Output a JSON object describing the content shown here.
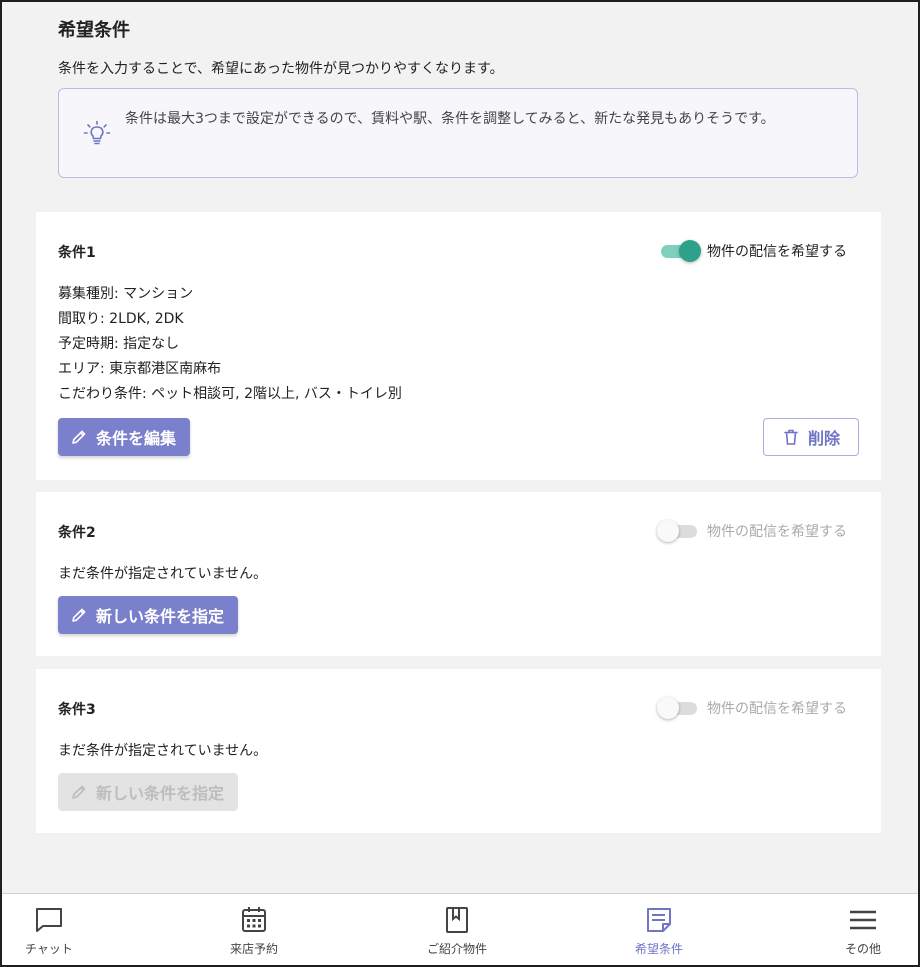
{
  "header": {
    "title": "希望条件",
    "description": "条件を入力することで、希望にあった物件が見つかりやすくなります。",
    "tip_icon": "lightbulb-icon",
    "tip_text": "条件は最大3つまで設定ができるので、賃料や駅、条件を調整してみると、新たな発見もありそうです。"
  },
  "conditions": [
    {
      "title": "条件1",
      "toggle_label": "物件の配信を希望する",
      "toggle_on": true,
      "details": [
        "募集種別: マンション",
        "間取り: 2LDK, 2DK",
        "予定時期: 指定なし",
        "エリア: 東京都港区南麻布",
        "こだわり条件: ペット相談可, 2階以上, バス・トイレ別"
      ],
      "edit_label": "条件を編集",
      "delete_label": "削除"
    },
    {
      "title": "条件2",
      "toggle_label": "物件の配信を希望する",
      "toggle_on": false,
      "empty_text": "まだ条件が指定されていません。",
      "new_label": "新しい条件を指定",
      "new_enabled": true
    },
    {
      "title": "条件3",
      "toggle_label": "物件の配信を希望する",
      "toggle_on": false,
      "empty_text": "まだ条件が指定されていません。",
      "new_label": "新しい条件を指定",
      "new_enabled": false
    }
  ],
  "nav": {
    "items": [
      {
        "label": "チャット",
        "icon": "chat-icon",
        "active": false
      },
      {
        "label": "来店予約",
        "icon": "calendar-icon",
        "active": false
      },
      {
        "label": "ご紹介物件",
        "icon": "bookmark-icon",
        "active": false
      },
      {
        "label": "希望条件",
        "icon": "note-icon",
        "active": true
      },
      {
        "label": "その他",
        "icon": "menu-icon",
        "active": false
      }
    ]
  },
  "colors": {
    "accent": "#7b80cc",
    "toggle_on": "#2fa08a",
    "background": "#f2f2f2"
  }
}
